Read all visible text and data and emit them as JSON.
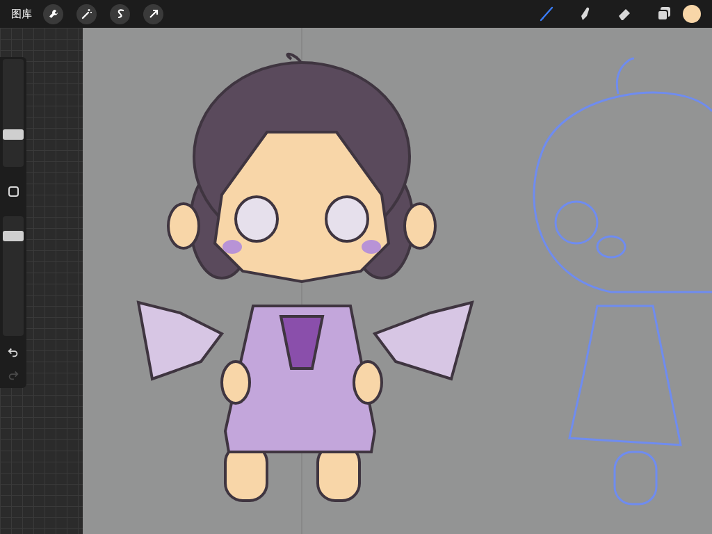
{
  "top_bar": {
    "gallery_label": "图库",
    "actions": [
      {
        "kind": "wrench"
      },
      {
        "kind": "wand"
      },
      {
        "kind": "selection"
      },
      {
        "kind": "transform"
      }
    ],
    "tools": [
      {
        "kind": "brush",
        "selected": true
      },
      {
        "kind": "smudge",
        "selected": false
      },
      {
        "kind": "eraser",
        "selected": false
      },
      {
        "kind": "layers",
        "selected": false
      }
    ],
    "color_swatch": {
      "color": "#f8d6a8"
    }
  },
  "sidebar": {
    "size_slider": {
      "level": 0.28
    },
    "opacity_slider": {
      "level": 0.85
    },
    "undo": {
      "disabled": false
    },
    "redo": {
      "disabled": true
    }
  }
}
